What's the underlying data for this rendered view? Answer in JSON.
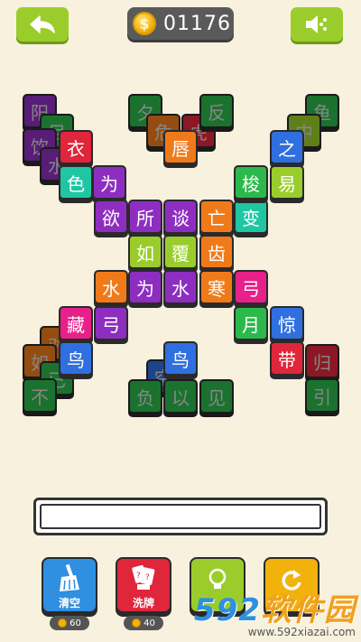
{
  "header": {
    "coins": "01176",
    "coin_symbol": "$",
    "back_icon": "back-arrow-icon",
    "sound_icon": "speaker-icon"
  },
  "tiles": [
    {
      "char": "阳",
      "color": "#8e2ec0",
      "dim": true
    },
    {
      "char": "目",
      "color": "#2cb84a",
      "dim": true
    },
    {
      "char": "饮",
      "color": "#8e2ec0",
      "dim": true
    },
    {
      "char": "水",
      "color": "#8e2ec0",
      "dim": true
    },
    {
      "char": "衣",
      "color": "#e0263a",
      "dim": false
    },
    {
      "char": "色",
      "color": "#20c6a2",
      "dim": false
    },
    {
      "char": "为",
      "color": "#8e2ec0",
      "dim": false
    },
    {
      "char": "欲",
      "color": "#8e2ec0",
      "dim": false
    },
    {
      "char": "所",
      "color": "#8e2ec0",
      "dim": false
    },
    {
      "char": "谈",
      "color": "#8e2ec0",
      "dim": false
    },
    {
      "char": "亡",
      "color": "#f07a1a",
      "dim": false
    },
    {
      "char": "变",
      "color": "#20c6a2",
      "dim": false
    },
    {
      "char": "夕",
      "color": "#2cb84a",
      "dim": true
    },
    {
      "char": "危",
      "color": "#f07a1a",
      "dim": true
    },
    {
      "char": "虎",
      "color": "#e0263a",
      "dim": true
    },
    {
      "char": "反",
      "color": "#2cb84a",
      "dim": true
    },
    {
      "char": "唇",
      "color": "#f07a1a",
      "dim": false
    },
    {
      "char": "鱼",
      "color": "#2cb84a",
      "dim": true
    },
    {
      "char": "中",
      "color": "#9acd2c",
      "dim": true
    },
    {
      "char": "之",
      "color": "#2f6fe0",
      "dim": false
    },
    {
      "char": "梭",
      "color": "#2cb84a",
      "dim": false
    },
    {
      "char": "易",
      "color": "#9acd2c",
      "dim": false
    },
    {
      "char": "如",
      "color": "#9acd2c",
      "dim": false
    },
    {
      "char": "覆",
      "color": "#9acd2c",
      "dim": false
    },
    {
      "char": "齿",
      "color": "#f07a1a",
      "dim": false
    },
    {
      "char": "水",
      "color": "#f07a1a",
      "dim": false
    },
    {
      "char": "为",
      "color": "#8e2ec0",
      "dim": false
    },
    {
      "char": "水",
      "color": "#8e2ec0",
      "dim": false
    },
    {
      "char": "寒",
      "color": "#f07a1a",
      "dim": false
    },
    {
      "char": "弓",
      "color": "#e8208a",
      "dim": false
    },
    {
      "char": "藏",
      "color": "#e8208a",
      "dim": false
    },
    {
      "char": "弓",
      "color": "#8e2ec0",
      "dim": false
    },
    {
      "char": "鸟",
      "color": "#2f6fe0",
      "dim": false
    },
    {
      "char": "对",
      "color": "#f07a1a",
      "dim": true
    },
    {
      "char": "如",
      "color": "#f07a1a",
      "dim": true
    },
    {
      "char": "已",
      "color": "#2cb84a",
      "dim": true
    },
    {
      "char": "不",
      "color": "#2cb84a",
      "dim": true
    },
    {
      "char": "月",
      "color": "#2cb84a",
      "dim": false
    },
    {
      "char": "惊",
      "color": "#2f6fe0",
      "dim": false
    },
    {
      "char": "带",
      "color": "#e0263a",
      "dim": false
    },
    {
      "char": "鸟",
      "color": "#2f6fe0",
      "dim": false
    },
    {
      "char": "空",
      "color": "#2f6fe0",
      "dim": true
    },
    {
      "char": "负",
      "color": "#2cb84a",
      "dim": true
    },
    {
      "char": "以",
      "color": "#2cb84a",
      "dim": true
    },
    {
      "char": "见",
      "color": "#2cb84a",
      "dim": true
    },
    {
      "char": "归",
      "color": "#e0263a",
      "dim": true
    },
    {
      "char": "引",
      "color": "#2cb84a",
      "dim": true
    }
  ],
  "tools": [
    {
      "label": "清空",
      "cost": "60",
      "color": "#2f8fe0",
      "icon": "broom-icon"
    },
    {
      "label": "洗牌",
      "cost": "40",
      "color": "#e0263a",
      "icon": "shuffle-cards-icon"
    },
    {
      "label": "",
      "cost": "",
      "color": "#9acd2c",
      "icon": "lightbulb-icon"
    },
    {
      "label": "",
      "cost": "",
      "color": "#f2b20c",
      "icon": "undo-icon"
    }
  ],
  "watermark": {
    "brand_num": "592",
    "brand_text": "软件园",
    "url": "www.592xiazai.com"
  }
}
